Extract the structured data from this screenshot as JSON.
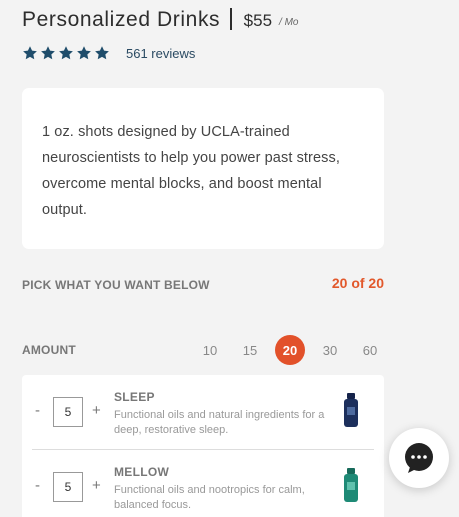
{
  "product": {
    "title": "Personalized Drinks",
    "price": "$55",
    "per": "/ Mo"
  },
  "rating": {
    "stars": 5,
    "reviews": "561 reviews",
    "star_color": "#1f4d6b"
  },
  "description": "1 oz. shots designed by UCLA-trained neuroscientists to help you power past stress, overcome mental blocks, and boost mental output.",
  "pick": {
    "label": "PICK WHAT YOU WANT BELOW",
    "count": "20 of 20"
  },
  "amount": {
    "label": "AMOUNT",
    "options": [
      "10",
      "15",
      "20",
      "30",
      "60"
    ],
    "selected": "20"
  },
  "items": [
    {
      "name": "SLEEP",
      "description": "Functional oils and natural ingredients for a deep, restorative sleep.",
      "quantity": "5",
      "minus": "-",
      "plus": "+",
      "bottle_color": "#1c2f5c",
      "bottle_icon": "sleep-bottle-icon"
    },
    {
      "name": "MELLOW",
      "description": "Functional oils and nootropics for calm, balanced focus.",
      "quantity": "5",
      "minus": "-",
      "plus": "+",
      "bottle_color": "#1e8a76",
      "bottle_icon": "mellow-bottle-icon"
    }
  ],
  "chat": {
    "icon": "chat-bubble-icon"
  },
  "colors": {
    "accent": "#e2512a",
    "background": "#f3f3f3"
  }
}
